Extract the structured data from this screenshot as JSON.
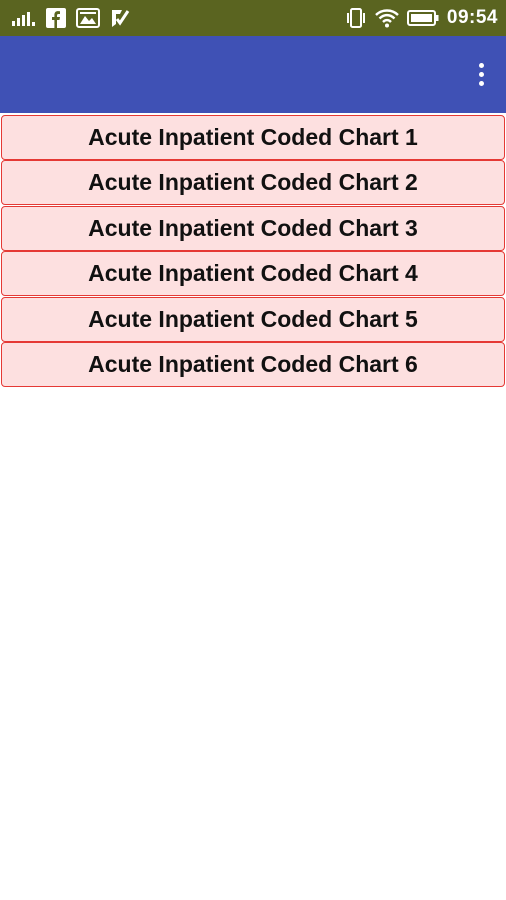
{
  "status_bar": {
    "time": "09:54",
    "left_icons": [
      "signal-icon",
      "facebook-icon",
      "gallery-icon",
      "check-app-icon"
    ],
    "right_icons": [
      "vibrate-icon",
      "wifi-icon",
      "battery-icon"
    ]
  },
  "app_bar": {
    "title": "",
    "menu_icon": "more-vert-icon",
    "color": "#3f51b5"
  },
  "chart_list": {
    "items": [
      {
        "label": "Acute Inpatient Coded Chart 1"
      },
      {
        "label": "Acute Inpatient Coded Chart 2"
      },
      {
        "label": "Acute Inpatient Coded Chart 3"
      },
      {
        "label": "Acute Inpatient Coded Chart 4"
      },
      {
        "label": "Acute Inpatient Coded Chart 5"
      },
      {
        "label": "Acute Inpatient Coded Chart 6"
      }
    ],
    "button_background": "#fde0e0",
    "button_border": "#e53935"
  },
  "colors": {
    "status_bar": "#5a6420",
    "app_bar": "#3f51b5",
    "background": "#ffffff"
  }
}
